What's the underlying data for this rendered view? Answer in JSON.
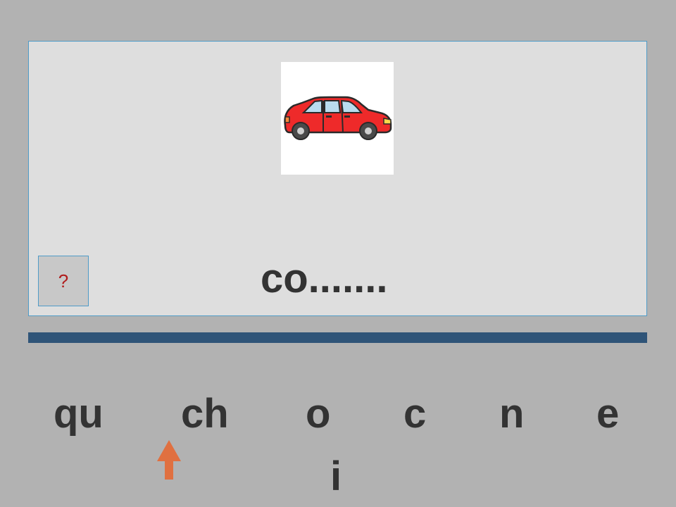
{
  "prompt": {
    "word": "co.......",
    "help_label": "?",
    "picture_icon": "red-car-icon"
  },
  "choices": [
    {
      "label": "qu"
    },
    {
      "label": "ch"
    },
    {
      "label": "o"
    },
    {
      "label": "c"
    },
    {
      "label": "n"
    },
    {
      "label": "e"
    },
    {
      "label": "i"
    }
  ],
  "colors": {
    "background": "#b2b2b2",
    "card": "#dedede",
    "card_border": "#4f9bc7",
    "divider": "#2f5478",
    "text": "#333333",
    "help_text": "#b01c1c",
    "arrow": "#e07040",
    "car": "#ee2a2a"
  },
  "pointer": {
    "icon": "up-arrow-icon",
    "target_choice": "ch"
  }
}
